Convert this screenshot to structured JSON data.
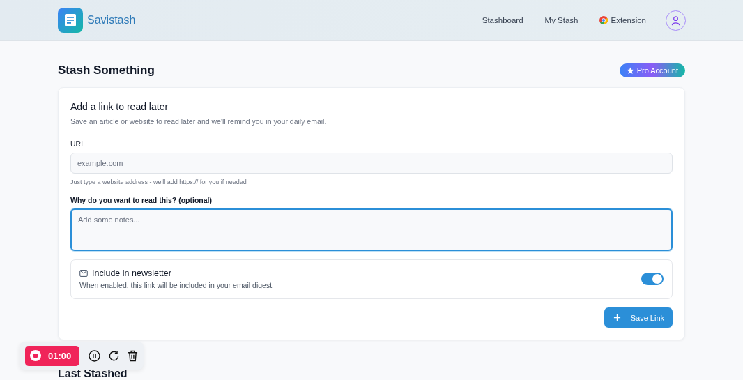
{
  "header": {
    "brand": "Savistash",
    "nav": [
      {
        "label": "Stashboard",
        "kind": "link"
      },
      {
        "label": "My Stash",
        "kind": "link"
      },
      {
        "label": "Extension",
        "kind": "extension"
      }
    ]
  },
  "page": {
    "title": "Stash Something",
    "badge": "Pro Account"
  },
  "form": {
    "title": "Add a link to read later",
    "subtitle": "Save an article or website to read later and we'll remind you in your daily email.",
    "url": {
      "label": "URL",
      "placeholder": "example.com",
      "hint": "Just type a website address - we'll add https:// for you if needed"
    },
    "notes": {
      "label": "Why do you want to read this? (optional)",
      "placeholder": "Add some notes...",
      "focused": true
    },
    "newsletter": {
      "title": "Include in newsletter",
      "description": "When enabled, this link will be included in your email digest.",
      "on": true
    },
    "submit": "Save Link"
  },
  "next_section": {
    "title": "Last Stashed"
  },
  "recorder": {
    "time": "01:00"
  }
}
